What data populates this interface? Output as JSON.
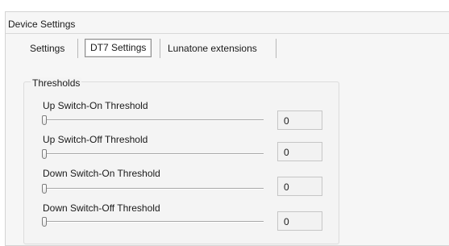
{
  "panel": {
    "title": "Device Settings"
  },
  "tabs": [
    {
      "label": "Settings",
      "selected": false
    },
    {
      "label": "DT7 Settings",
      "selected": true
    },
    {
      "label": "Lunatone extensions",
      "selected": false
    }
  ],
  "thresholds": {
    "title": "Thresholds",
    "rows": [
      {
        "label": "Up Switch-On Threshold",
        "value": "0",
        "slider_level": 0
      },
      {
        "label": "Up Switch-Off Threshold",
        "value": "0",
        "slider_level": 0
      },
      {
        "label": "Down Switch-On Threshold",
        "value": "0",
        "slider_level": 0
      },
      {
        "label": "Down Switch-Off Threshold",
        "value": "0",
        "slider_level": 0
      }
    ]
  }
}
